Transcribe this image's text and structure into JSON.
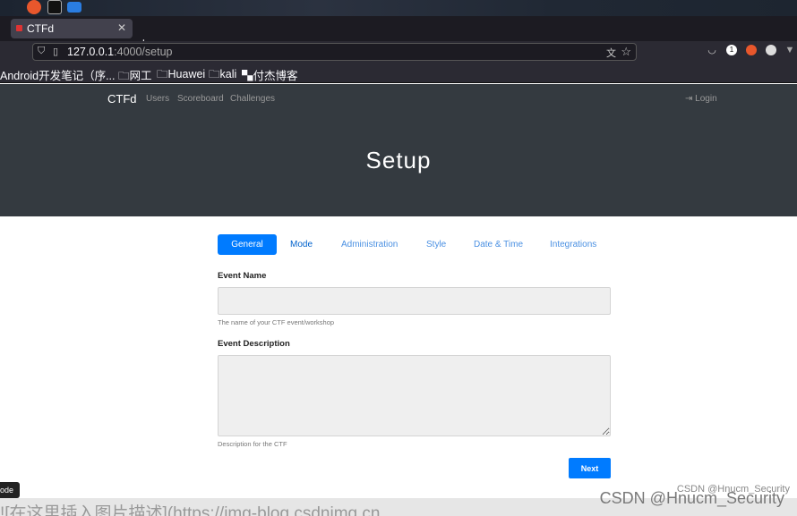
{
  "browser": {
    "tab_title": "CTFd",
    "url_host": "127.0.0.1",
    "url_rest": ":4000/setup",
    "bookmarks": [
      "Android开发笔记（序...",
      "网工",
      "Huawei",
      "kali",
      "付杰博客"
    ],
    "extension_badge": "1"
  },
  "site": {
    "brand": "CTFd",
    "nav": [
      "Users",
      "Scoreboard",
      "Challenges"
    ],
    "login": "Login",
    "hero_title": "Setup"
  },
  "setup": {
    "tabs": [
      {
        "label": "General"
      },
      {
        "label": "Mode"
      },
      {
        "label": "Administration"
      },
      {
        "label": "Style"
      },
      {
        "label": "Date & Time"
      },
      {
        "label": "Integrations"
      }
    ],
    "event_name_label": "Event Name",
    "event_name_value": "",
    "event_name_help": "The name of your CTF event/workshop",
    "event_desc_label": "Event Description",
    "event_desc_value": "",
    "event_desc_help": "Description for the CTF",
    "next_label": "Next"
  },
  "overlay": {
    "mode_badge": "ode",
    "footer_text": "![在这里插入图片描述](https://img-blog.csdnimg.cn",
    "watermark_small": "CSDN @Hnucm_Security",
    "watermark_large": "CSDN @Hnucm_Security"
  },
  "colors": {
    "primary": "#007bff",
    "navbar": "#343a40"
  }
}
